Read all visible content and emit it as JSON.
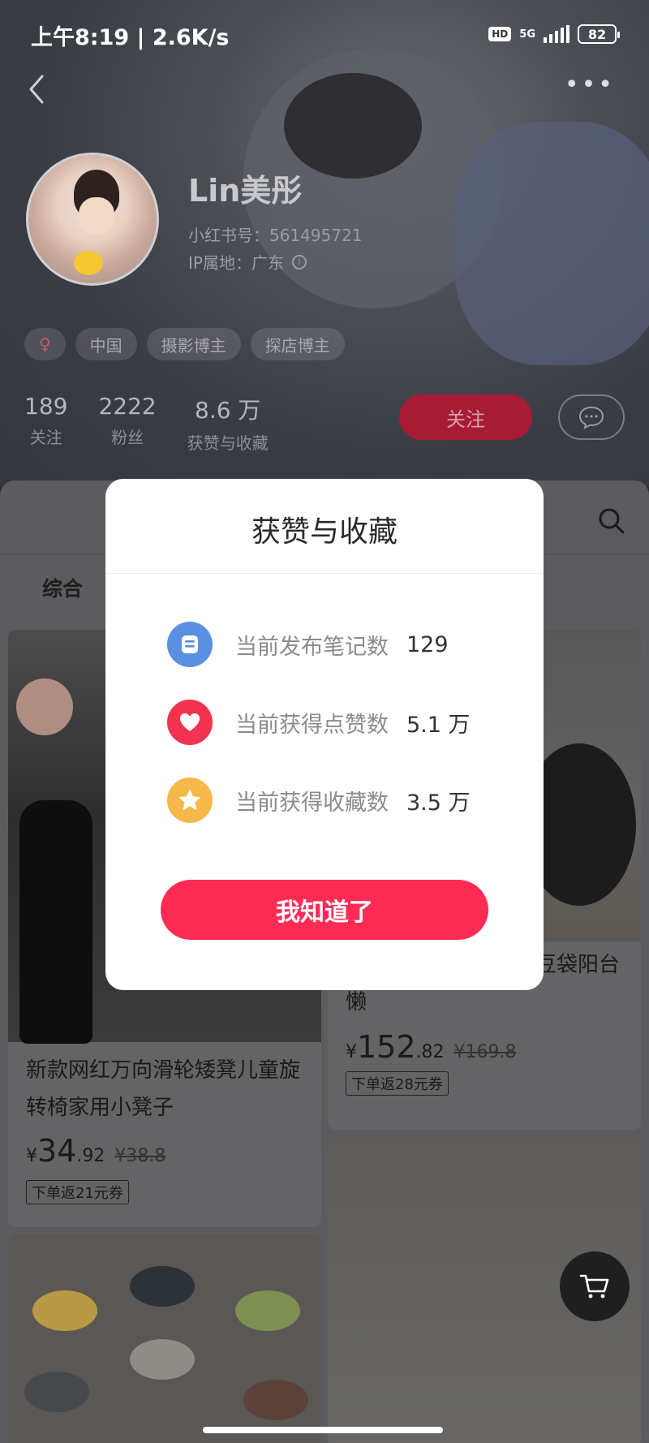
{
  "status_bar": {
    "time_speed": "上午8:19 | 2.6K/s",
    "hd": "HD",
    "network": "5G",
    "battery": "82"
  },
  "profile": {
    "name": "Lin美彤",
    "id_line": "小红书号：561495721",
    "ip_line": "IP属地：广东",
    "tags": [
      "♀",
      "中国",
      "摄影博主",
      "探店博主"
    ],
    "stats": [
      {
        "num": "189",
        "label": "关注"
      },
      {
        "num": "2222",
        "label": "粉丝"
      },
      {
        "num": "8.6 万",
        "label": "获赞与收藏"
      }
    ],
    "follow_label": "关注"
  },
  "tabs": {
    "active": "综合"
  },
  "products": [
    {
      "title": "新款网红万向滑轮矮凳儿童旋转椅家用小凳子",
      "yen": "¥",
      "price_int": "34",
      "price_dec": ".92",
      "orig": "¥38.8",
      "coupon": "下单返21元券"
    },
    {
      "title": "轻奢榻榻米可躺可睡豆袋阳台懒",
      "yen": "¥",
      "price_int": "152",
      "price_dec": ".82",
      "orig": "¥169.8",
      "coupon": "下单返28元券"
    }
  ],
  "modal": {
    "title": "获赞与收藏",
    "rows": [
      {
        "label": "当前发布笔记数",
        "value": "129",
        "icon": "note-icon",
        "color": "#5b8fe0"
      },
      {
        "label": "当前获得点赞数",
        "value": "5.1 万",
        "icon": "heart-icon",
        "color": "#f2324f"
      },
      {
        "label": "当前获得收藏数",
        "value": "3.5 万",
        "icon": "star-icon",
        "color": "#f6b84a"
      }
    ],
    "button": "我知道了"
  }
}
